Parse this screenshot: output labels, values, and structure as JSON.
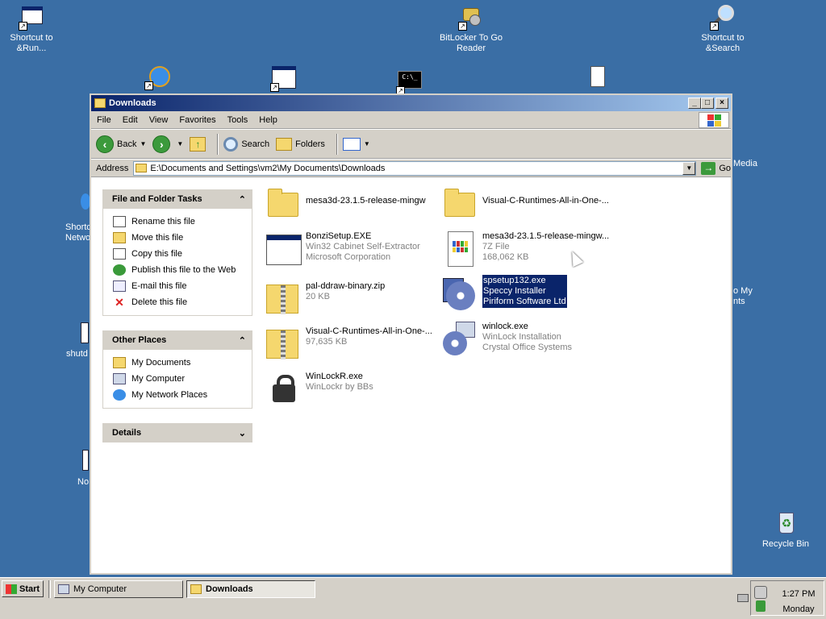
{
  "desktop": {
    "icons": [
      {
        "label": "Shortcut to &Run...",
        "icon": "run-icon"
      },
      {
        "label": "BitLocker To Go Reader",
        "icon": "keys-icon"
      },
      {
        "label": "Shortcut to &Search",
        "icon": "search-icon"
      },
      {
        "label": "Recycle Bin",
        "icon": "recycle-bin-icon"
      }
    ],
    "partial_labels": {
      "shortcut_netw_1": "Shortc",
      "shortcut_netw_2": "Netwo",
      "shutd": "shutd",
      "no": "No",
      "media": "Media",
      "to_my_1": "o My",
      "to_my_2": "nts"
    }
  },
  "window": {
    "title": "Downloads",
    "menu": [
      "File",
      "Edit",
      "View",
      "Favorites",
      "Tools",
      "Help"
    ],
    "toolbar": {
      "back": "Back",
      "search": "Search",
      "folders": "Folders"
    },
    "address": {
      "label": "Address",
      "value": "E:\\Documents and Settings\\vm2\\My Documents\\Downloads",
      "go": "Go"
    }
  },
  "tasks": {
    "file_folder": {
      "title": "File and Folder Tasks",
      "items": [
        "Rename this file",
        "Move this file",
        "Copy this file",
        "Publish this file to the Web",
        "E-mail this file",
        "Delete this file"
      ]
    },
    "other_places": {
      "title": "Other Places",
      "items": [
        "My Documents",
        "My Computer",
        "My Network Places"
      ]
    },
    "details": {
      "title": "Details"
    }
  },
  "files": [
    {
      "name": "mesa3d-23.1.5-release-mingw",
      "l1": "",
      "l2": "",
      "icon": "folder-icon"
    },
    {
      "name": "Visual-C-Runtimes-All-in-One-...",
      "l1": "",
      "l2": "",
      "icon": "folder-icon"
    },
    {
      "name": "BonziSetup.EXE",
      "l1": "Win32 Cabinet Self-Extractor",
      "l2": "Microsoft Corporation",
      "icon": "application-icon"
    },
    {
      "name": "mesa3d-23.1.5-release-mingw...",
      "l1": "7Z File",
      "l2": "168,062 KB",
      "icon": "7z-file-icon"
    },
    {
      "name": "pal-ddraw-binary.zip",
      "l1": "20 KB",
      "l2": "",
      "icon": "zip-icon"
    },
    {
      "name": "spsetup132.exe",
      "l1": "Speccy Installer",
      "l2": "Piriform Software Ltd",
      "icon": "installer-icon"
    },
    {
      "name": "Visual-C-Runtimes-All-in-One-...",
      "l1": "97,635 KB",
      "l2": "",
      "icon": "zip-icon"
    },
    {
      "name": "winlock.exe",
      "l1": "WinLock Installation",
      "l2": "Crystal Office Systems",
      "icon": "installer-cd-icon"
    },
    {
      "name": "WinLockR.exe",
      "l1": "WinLockr by BBs",
      "l2": "",
      "icon": "lock-icon"
    }
  ],
  "taskbar": {
    "start": "Start",
    "tasks": [
      "My Computer",
      "Downloads"
    ],
    "time": "1:27 PM",
    "day": "Monday"
  }
}
